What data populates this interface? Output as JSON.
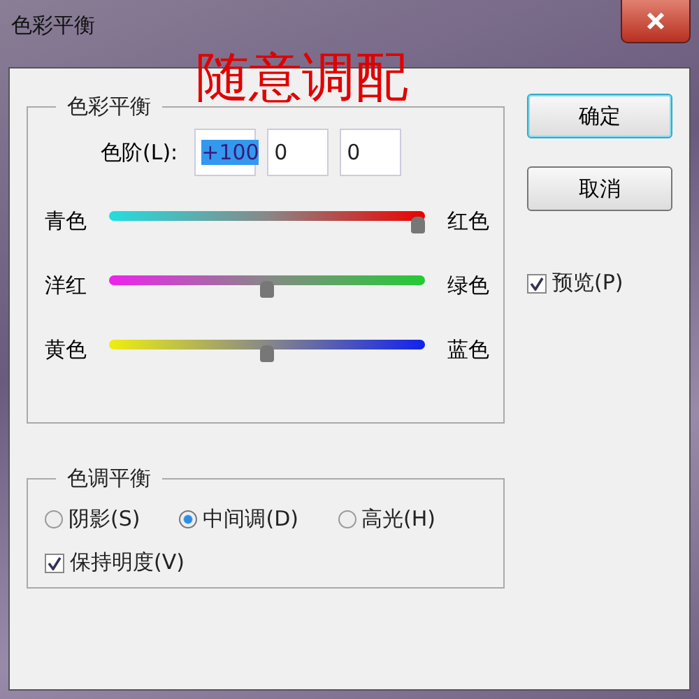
{
  "window": {
    "title": "色彩平衡"
  },
  "annotation": "随意调配",
  "color_balance": {
    "title": "色彩平衡",
    "levels_label": "色阶(L):",
    "levels": [
      {
        "value": "+100",
        "selected": true
      },
      {
        "value": "0",
        "selected": false
      },
      {
        "value": "0",
        "selected": false
      }
    ],
    "sliders": [
      {
        "left": "青色",
        "right": "红色",
        "level": 1
      },
      {
        "left": "洋红",
        "right": "绿色",
        "level": 0.5
      },
      {
        "left": "黄色",
        "right": "蓝色",
        "level": 0.5
      }
    ]
  },
  "tone_balance": {
    "title": "色调平衡",
    "options": [
      {
        "label": "阴影(S)",
        "selected": false
      },
      {
        "label": "中间调(D)",
        "selected": true
      },
      {
        "label": "高光(H)",
        "selected": false
      }
    ],
    "preserve": {
      "label": "保持明度(V)",
      "checked": true
    }
  },
  "buttons": [
    {
      "label": "确定",
      "default": true
    },
    {
      "label": "取消",
      "default": false
    }
  ],
  "preview": {
    "label": "预览(P)",
    "checked": true
  }
}
